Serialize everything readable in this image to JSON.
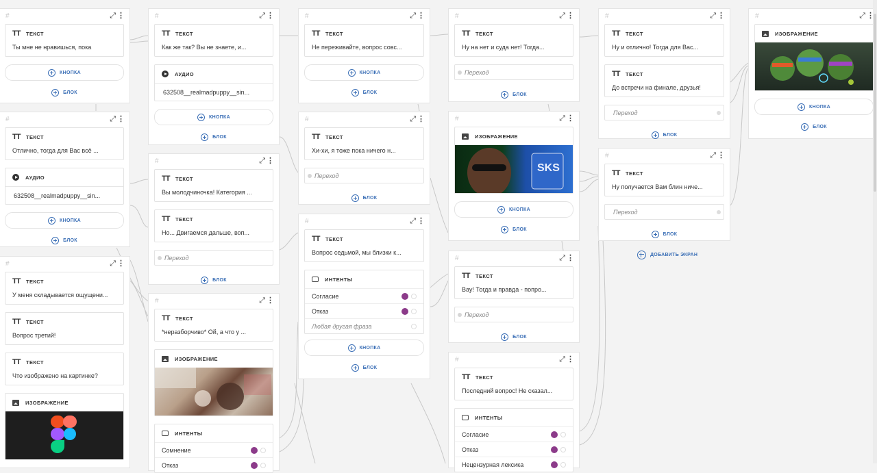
{
  "labels": {
    "text": "Текст",
    "audio": "Аудио",
    "image": "Изображение",
    "intents": "Интенты",
    "button": "кнопка",
    "block": "блок",
    "transition": "Переход",
    "hash": "#",
    "add_screen": "добавить экран"
  },
  "icons": {
    "expand": "expand-icon",
    "more": "more-vertical-icon",
    "text": "text-type-icon",
    "audio": "play-icon",
    "image": "image-icon",
    "intents": "chat-icon",
    "plus": "plus-circle-icon"
  },
  "colors": {
    "accent": "#3b6fb6",
    "intent_dot": "#8c3b8a",
    "canvas": "#f3f3f3"
  },
  "screens": {
    "s1": {
      "t1": "Ты мне не нравишься, пока"
    },
    "s2": {
      "t1": "Отлично, тогда для Вас всё ...",
      "audio": "632508__realmadpuppy__sin..."
    },
    "s3": {
      "t1": "У меня складывается ощущени...",
      "t2": "Вопрос третий!",
      "t3": "Что изображено на картинке?"
    },
    "s4": {
      "t1": "Как же так? Вы не знаете, и...",
      "audio": "632508__realmadpuppy__sin..."
    },
    "s5": {
      "t1": "Вы молодчиночка! Категория ...",
      "t2": "Но... Двигаемся дальше, воп..."
    },
    "s6": {
      "t1": "*неразборчиво* Ой, а что у ...",
      "intents": [
        "Сомнение",
        "Отказ"
      ]
    },
    "s7": {
      "t1": "Не переживайте, вопрос совс..."
    },
    "s8": {
      "t1": "Хи-хи, я тоже пока ничего н..."
    },
    "s9": {
      "t1": "Вопрос седьмой, мы близки к...",
      "intents": [
        "Согласие",
        "Отказ"
      ],
      "any": "Любая другая фраза"
    },
    "s10": {
      "t1": "Ну на нет и суда нет! Тогда..."
    },
    "s11": {
      "logo_text": "SKS"
    },
    "s12": {
      "t1": "Вау! Тогда и правда - попро..."
    },
    "s13": {
      "t1": "Последний вопрос! Не сказал...",
      "intents": [
        "Согласие",
        "Отказ",
        "Нецензурная лексика"
      ]
    },
    "s14": {
      "t1": "Ну и отлично! Тогда для Вас...",
      "t2": "До встречи на финале, друзья!"
    },
    "s15": {
      "t1": "Ну получается Вам блин ниче..."
    }
  }
}
